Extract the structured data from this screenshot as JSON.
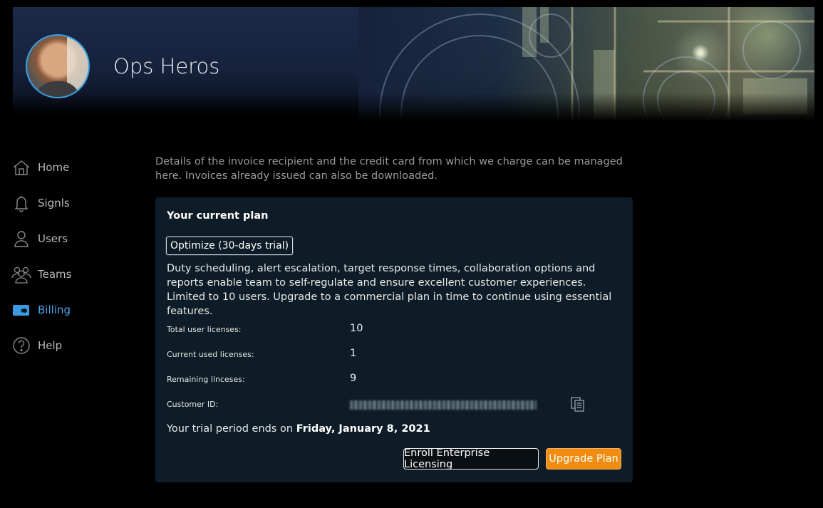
{
  "header": {
    "org_name": "Ops Heros",
    "avatar_icon": "user-avatar"
  },
  "sidebar": {
    "active_color": "#4aa3e8",
    "items": [
      {
        "label": "Home",
        "icon": "home-icon"
      },
      {
        "label": "Signls",
        "icon": "bell-icon"
      },
      {
        "label": "Users",
        "icon": "user-icon"
      },
      {
        "label": "Teams",
        "icon": "team-icon"
      },
      {
        "label": "Billing",
        "icon": "credit-card-icon",
        "active": true
      },
      {
        "label": "Help",
        "icon": "help-icon"
      }
    ]
  },
  "main": {
    "intro": "Details of the invoice recipient and the credit card from which we charge can be managed here. Invoices already issued can also be downloaded.",
    "plan_card": {
      "title": "Your current plan",
      "plan_name": "Optimize (30-days trial)",
      "description": "Duty scheduling, alert escalation, target response times, collaboration options and reports enable team to self-regulate and ensure excellent customer experiences. Limited to 10 users. Upgrade to a commercial plan in time to continue using essential features.",
      "rows": [
        {
          "label": "Total user licenses:",
          "value": "10"
        },
        {
          "label": "Current used licenses:",
          "value": "1"
        },
        {
          "label": "Remaining linceses:",
          "value": "9"
        },
        {
          "label": "Customer ID:",
          "value": ""
        }
      ],
      "trial_prefix": "Your trial period ends on ",
      "trial_date": "Friday, January 8, 2021",
      "enroll_button": "Enroll Enterprise Licensing",
      "upgrade_button": "Upgrade Plan",
      "upgrade_color": "#f08c10"
    }
  }
}
